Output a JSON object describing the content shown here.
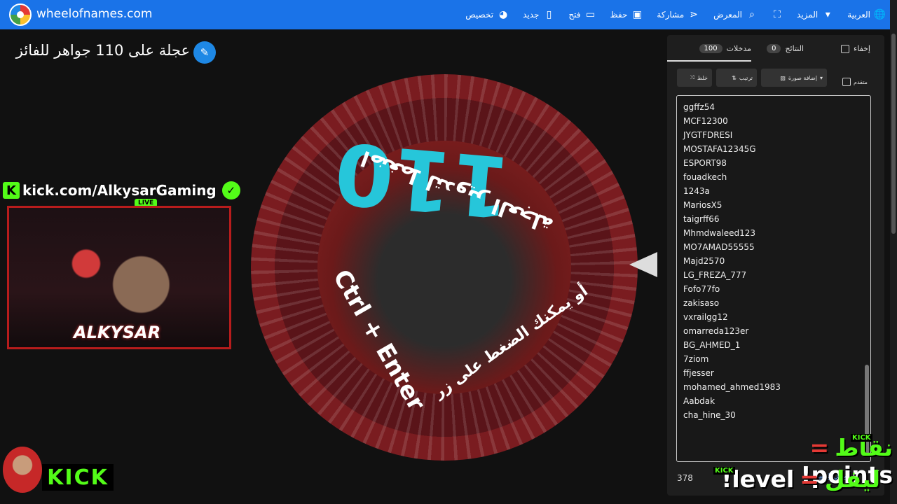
{
  "header": {
    "site_name": "wheelofnames.com",
    "nav": [
      {
        "label": "العربية",
        "icon": "globe-icon"
      },
      {
        "label": "المزيد",
        "icon": "caret-down-icon"
      },
      {
        "label": "",
        "icon": "fullscreen-icon"
      },
      {
        "label": "المعرض",
        "icon": "search-icon"
      },
      {
        "label": "مشاركة",
        "icon": "share-icon"
      },
      {
        "label": "حفظ",
        "icon": "save-icon"
      },
      {
        "label": "فتح",
        "icon": "folder-icon"
      },
      {
        "label": "جديد",
        "icon": "file-icon"
      },
      {
        "label": "تخصيص",
        "icon": "palette-icon"
      }
    ]
  },
  "wheel": {
    "title": "عجلة على 110 جواهر للفائز",
    "center_number": "110",
    "hint_arabic": "اضغط لتدوير العجلة",
    "hint_shortcut": "Ctrl + Enter",
    "hint_arabic_2": "أو يمكنك الضغط على زر"
  },
  "stream": {
    "kick_url": "kick.com/AlkysarGaming",
    "live_label": "LIVE",
    "cam_brand": "ALKYSAR",
    "kick_logo": "KICK"
  },
  "panel": {
    "tabs": {
      "entries_label": "مدخلات",
      "entries_count": "100",
      "results_label": "النتائج",
      "results_count": "0",
      "hide_label": "إخفاء"
    },
    "toolbar": {
      "shuffle": "خلط",
      "sort": "ترتيب",
      "add_image": "إضافة صورة",
      "advanced": "متقدم"
    },
    "entries": [
      "ggffz54",
      "MCF12300",
      "JYGTFDRESI",
      "MOSTAFA12345G",
      "ESPORT98",
      "fouadkech",
      "1243a",
      "MariosX5",
      "taigrff66",
      "Mhmdwaleed123",
      "MO7AMAD55555",
      "Majd2570",
      "LG_FREZA_777",
      "Fofo77fo",
      "zakisaso",
      "vxrailgg12",
      "omarreda123er",
      "BG_AHMED_1",
      "7ziom",
      "ffjesser",
      "mohamed_ahmed1983",
      "Aabdak",
      "cha_hine_30"
    ],
    "footer_count": "378",
    "footer_link": "سجل التغيير"
  },
  "overlays": {
    "points_ar": "نقاط",
    "points_eq": "=",
    "points_en": "!points",
    "level_ar": "ليفل",
    "level_eq": "=",
    "level_en": "!level",
    "kick_small": "KICK"
  }
}
